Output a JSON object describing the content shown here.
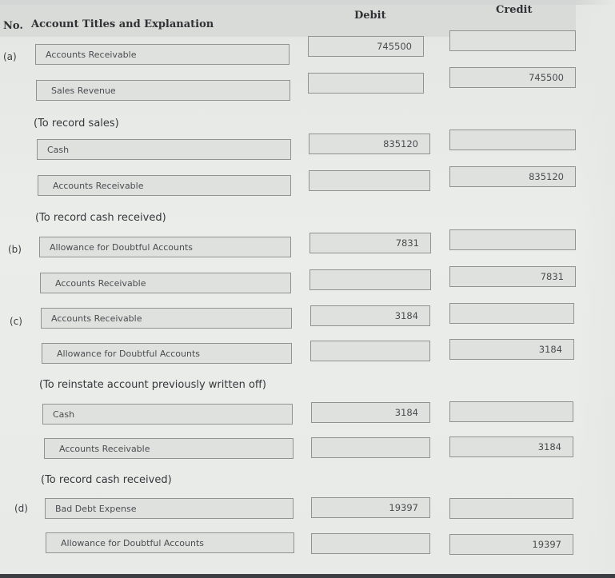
{
  "header": {
    "no": "No.",
    "account_titles": "Account Titles and Explanation",
    "debit": "Debit",
    "credit": "Credit"
  },
  "entries": [
    {
      "label": "(a)",
      "lines": [
        {
          "account": "Accounts Receivable",
          "debit": "745500",
          "credit": ""
        },
        {
          "account": "Sales Revenue",
          "debit": "",
          "credit": "745500"
        }
      ],
      "explanation": "(To record sales)"
    },
    {
      "label": "",
      "lines": [
        {
          "account": "Cash",
          "debit": "835120",
          "credit": ""
        },
        {
          "account": "Accounts Receivable",
          "debit": "",
          "credit": "835120"
        }
      ],
      "explanation": "(To record cash received)"
    },
    {
      "label": "(b)",
      "lines": [
        {
          "account": "Allowance for Doubtful Accounts",
          "debit": "7831",
          "credit": ""
        },
        {
          "account": "Accounts Receivable",
          "debit": "",
          "credit": "7831"
        }
      ],
      "explanation": ""
    },
    {
      "label": "(c)",
      "lines": [
        {
          "account": "Accounts Receivable",
          "debit": "3184",
          "credit": ""
        },
        {
          "account": "Allowance for Doubtful Accounts",
          "debit": "",
          "credit": "3184"
        }
      ],
      "explanation": "(To reinstate account previously written off)"
    },
    {
      "label": "",
      "lines": [
        {
          "account": "Cash",
          "debit": "3184",
          "credit": ""
        },
        {
          "account": "Accounts Receivable",
          "debit": "",
          "credit": "3184"
        }
      ],
      "explanation": "(To record cash received)"
    },
    {
      "label": "(d)",
      "lines": [
        {
          "account": "Bad Debt Expense",
          "debit": "19397",
          "credit": ""
        },
        {
          "account": "Allowance for Doubtful Accounts",
          "debit": "",
          "credit": "19397"
        }
      ],
      "explanation": ""
    }
  ]
}
